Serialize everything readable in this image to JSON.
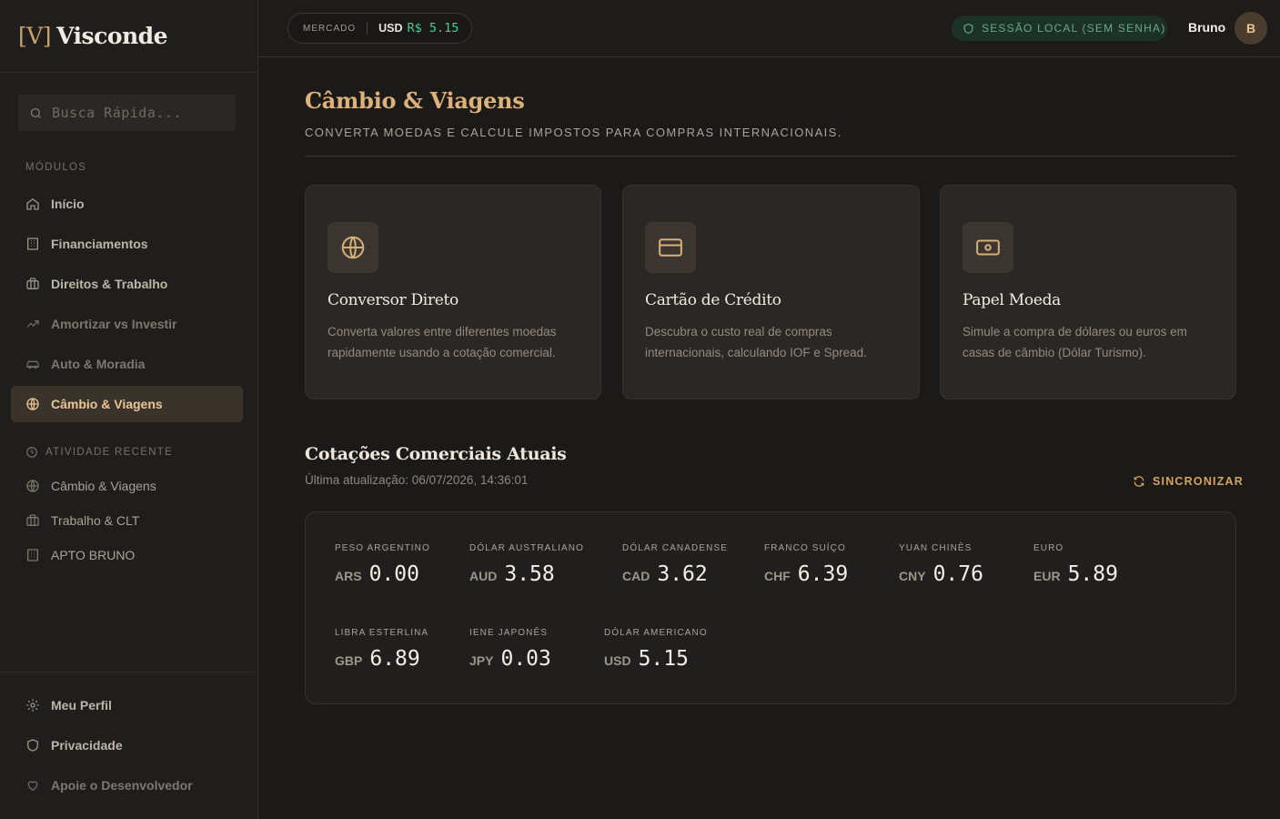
{
  "brand": {
    "mark": "[V]",
    "name": "Visconde"
  },
  "search": {
    "placeholder": "Busca Rápida..."
  },
  "sidebar": {
    "modules_label": "MÓDULOS",
    "items": [
      {
        "label": "Início",
        "icon": "home-icon"
      },
      {
        "label": "Financiamentos",
        "icon": "building-icon"
      },
      {
        "label": "Direitos & Trabalho",
        "icon": "briefcase-icon"
      },
      {
        "label": "Amortizar vs Investir",
        "icon": "trend-icon"
      },
      {
        "label": "Auto & Moradia",
        "icon": "car-icon"
      },
      {
        "label": "Câmbio & Viagens",
        "icon": "globe-icon"
      }
    ],
    "recent_label": "ATIVIDADE RECENTE",
    "recent": [
      {
        "label": "Câmbio & Viagens",
        "icon": "globe-icon"
      },
      {
        "label": "Trabalho & CLT",
        "icon": "briefcase-icon"
      },
      {
        "label": "APTO BRUNO",
        "icon": "building-icon"
      }
    ],
    "bottom": [
      {
        "label": "Meu Perfil",
        "icon": "gear-icon"
      },
      {
        "label": "Privacidade",
        "icon": "shield-icon"
      },
      {
        "label": "Apoie o Desenvolvedor",
        "icon": "heart-icon"
      }
    ]
  },
  "topbar": {
    "market_label": "MERCADO",
    "market_currency": "USD",
    "market_value": "R$ 5.15",
    "session": "SESSÃO LOCAL (SEM SENHA)",
    "user": "Bruno",
    "avatar": "B"
  },
  "page": {
    "title": "Câmbio & Viagens",
    "subtitle": "CONVERTA MOEDAS E CALCULE IMPOSTOS PARA COMPRAS INTERNACIONAIS."
  },
  "cards": [
    {
      "title": "Conversor Direto",
      "desc": "Converta valores entre diferentes moedas rapidamente usando a cotação comercial.",
      "icon": "globe-icon"
    },
    {
      "title": "Cartão de Crédito",
      "desc": "Descubra o custo real de compras internacionais, calculando IOF e Spread.",
      "icon": "credit-card-icon"
    },
    {
      "title": "Papel Moeda",
      "desc": "Simule a compra de dólares ou euros em casas de câmbio (Dólar Turismo).",
      "icon": "banknote-icon"
    }
  ],
  "quotes": {
    "title": "Cotações Comerciais Atuais",
    "updated": "Última atualização: 06/07/2026, 14:36:01",
    "sync_label": "SINCRONIZAR",
    "items": [
      {
        "name": "PESO ARGENTINO",
        "code": "ARS",
        "value": "0.00"
      },
      {
        "name": "DÓLAR AUSTRALIANO",
        "code": "AUD",
        "value": "3.58"
      },
      {
        "name": "DÓLAR CANADENSE",
        "code": "CAD",
        "value": "3.62"
      },
      {
        "name": "FRANCO SUÍÇO",
        "code": "CHF",
        "value": "6.39"
      },
      {
        "name": "YUAN CHINÊS",
        "code": "CNY",
        "value": "0.76"
      },
      {
        "name": "EURO",
        "code": "EUR",
        "value": "5.89"
      },
      {
        "name": "LIBRA ESTERLINA",
        "code": "GBP",
        "value": "6.89"
      },
      {
        "name": "IENE JAPONÊS",
        "code": "JPY",
        "value": "0.03"
      },
      {
        "name": "DÓLAR AMERICANO",
        "code": "USD",
        "value": "5.15"
      }
    ]
  },
  "colors": {
    "accent": "#ddb27a",
    "active_bg": "#3a332b",
    "positive": "#3fd08b",
    "session_bg": "#1c3226"
  }
}
